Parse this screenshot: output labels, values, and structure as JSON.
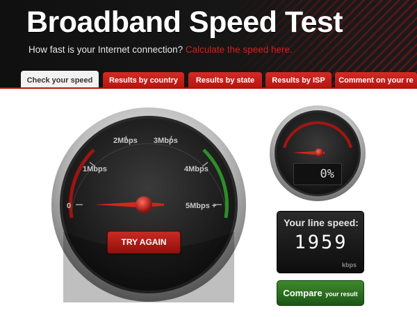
{
  "header": {
    "title": "Broadband Speed Test",
    "subtitle": "How fast is your Internet connection?",
    "subtitle_link": "Calculate the speed here."
  },
  "tabs": [
    {
      "label": "Check your speed",
      "active": true
    },
    {
      "label": "Results by country",
      "active": false
    },
    {
      "label": "Results by state",
      "active": false
    },
    {
      "label": "Results by ISP",
      "active": false
    },
    {
      "label": "Comment on your re",
      "active": false
    }
  ],
  "gauge": {
    "labels": [
      "0",
      "1Mbps",
      "2Mbps",
      "3Mbps",
      "4Mbps",
      "5Mbps +"
    ],
    "try_again_label": "TRY AGAIN",
    "needle_value": 0
  },
  "progress": {
    "value": "0%",
    "fraction": 0
  },
  "line_speed": {
    "title": "Your line speed:",
    "value": "1959",
    "unit": "kbps"
  },
  "compare": {
    "main": "Compare",
    "sub": "your result"
  },
  "colors": {
    "accent_red": "#c8201a",
    "button_green": "#2f7a22",
    "gauge_dark": "#1c1c1c"
  }
}
